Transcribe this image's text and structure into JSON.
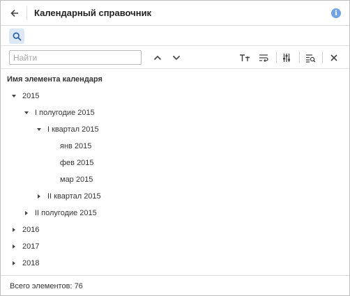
{
  "header": {
    "title": "Календарный справочник",
    "back_icon": "arrow-left-icon",
    "info_icon": "info-icon"
  },
  "search": {
    "toggle_icon": "search-icon",
    "placeholder": "Найти",
    "value": ""
  },
  "toolbar": {
    "icons": [
      "chevron-up-icon",
      "chevron-down-icon",
      "text-case-icon",
      "word-wrap-icon",
      "filter-sliders-icon",
      "find-in-list-icon",
      "close-icon"
    ]
  },
  "tree": {
    "column_header": "Имя элемента календаря",
    "nodes": [
      {
        "label": "2015",
        "level": 0,
        "state": "expanded"
      },
      {
        "label": "I полугодие 2015",
        "level": 1,
        "state": "expanded"
      },
      {
        "label": "I квартал 2015",
        "level": 2,
        "state": "expanded"
      },
      {
        "label": "янв 2015",
        "level": 3,
        "state": "leaf"
      },
      {
        "label": "фев 2015",
        "level": 3,
        "state": "leaf"
      },
      {
        "label": "мар 2015",
        "level": 3,
        "state": "leaf"
      },
      {
        "label": "II квартал 2015",
        "level": 2,
        "state": "collapsed"
      },
      {
        "label": "II полугодие 2015",
        "level": 1,
        "state": "collapsed"
      },
      {
        "label": "2016",
        "level": 0,
        "state": "collapsed"
      },
      {
        "label": "2017",
        "level": 0,
        "state": "collapsed"
      },
      {
        "label": "2018",
        "level": 0,
        "state": "collapsed"
      }
    ]
  },
  "footer": {
    "total_label": "Всего элементов:",
    "total_count": "76"
  },
  "colors": {
    "accent": "#6fa3e6",
    "search_toggle_bg": "#dde8f7",
    "border": "#d9d9d9"
  }
}
